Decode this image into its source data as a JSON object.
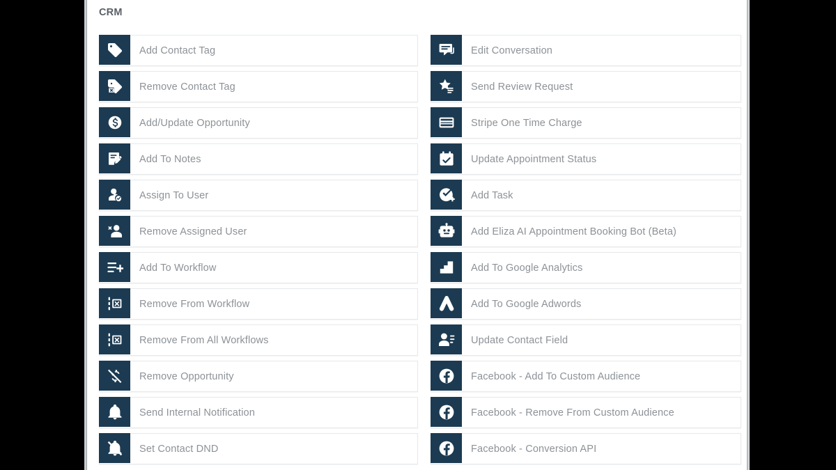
{
  "section": {
    "title": "CRM"
  },
  "theme": {
    "icon_tile_bg": "#1c3b52",
    "label_text": "#8d9297",
    "title_text": "#5a6066",
    "row_border": "#e6e8ea",
    "panel_bg": "#ffffff",
    "letterbox_bg": "#000000"
  },
  "columns": {
    "left": [
      {
        "label": "Add Contact Tag",
        "icon": "tag-icon"
      },
      {
        "label": "Remove Contact Tag",
        "icon": "tag-remove-icon"
      },
      {
        "label": "Add/Update Opportunity",
        "icon": "dollar-circle-icon"
      },
      {
        "label": "Add To Notes",
        "icon": "note-edit-icon"
      },
      {
        "label": "Assign To User",
        "icon": "user-check-icon"
      },
      {
        "label": "Remove Assigned User",
        "icon": "user-remove-icon"
      },
      {
        "label": "Add To Workflow",
        "icon": "list-plus-icon"
      },
      {
        "label": "Remove From Workflow",
        "icon": "workflow-remove-icon"
      },
      {
        "label": "Remove From All Workflows",
        "icon": "workflow-remove-all-icon"
      },
      {
        "label": "Remove Opportunity",
        "icon": "dollar-slash-icon"
      },
      {
        "label": "Send Internal Notification",
        "icon": "bell-icon"
      },
      {
        "label": "Set Contact DND",
        "icon": "bell-slash-icon"
      }
    ],
    "right": [
      {
        "label": "Edit Conversation",
        "icon": "chat-bubble-icon"
      },
      {
        "label": "Send Review Request",
        "icon": "star-review-icon"
      },
      {
        "label": "Stripe One Time Charge",
        "icon": "credit-card-icon"
      },
      {
        "label": "Update Appointment Status",
        "icon": "calendar-check-icon"
      },
      {
        "label": "Add Task",
        "icon": "task-check-icon"
      },
      {
        "label": "Add Eliza AI Appointment Booking Bot (Beta)",
        "icon": "robot-icon"
      },
      {
        "label": "Add To Google Analytics",
        "icon": "bar-step-icon"
      },
      {
        "label": "Add To Google Adwords",
        "icon": "adwords-icon"
      },
      {
        "label": "Update Contact Field",
        "icon": "contact-field-icon"
      },
      {
        "label": "Facebook - Add To Custom Audience",
        "icon": "facebook-icon"
      },
      {
        "label": "Facebook - Remove From Custom Audience",
        "icon": "facebook-icon"
      },
      {
        "label": "Facebook - Conversion API",
        "icon": "facebook-icon"
      }
    ]
  }
}
